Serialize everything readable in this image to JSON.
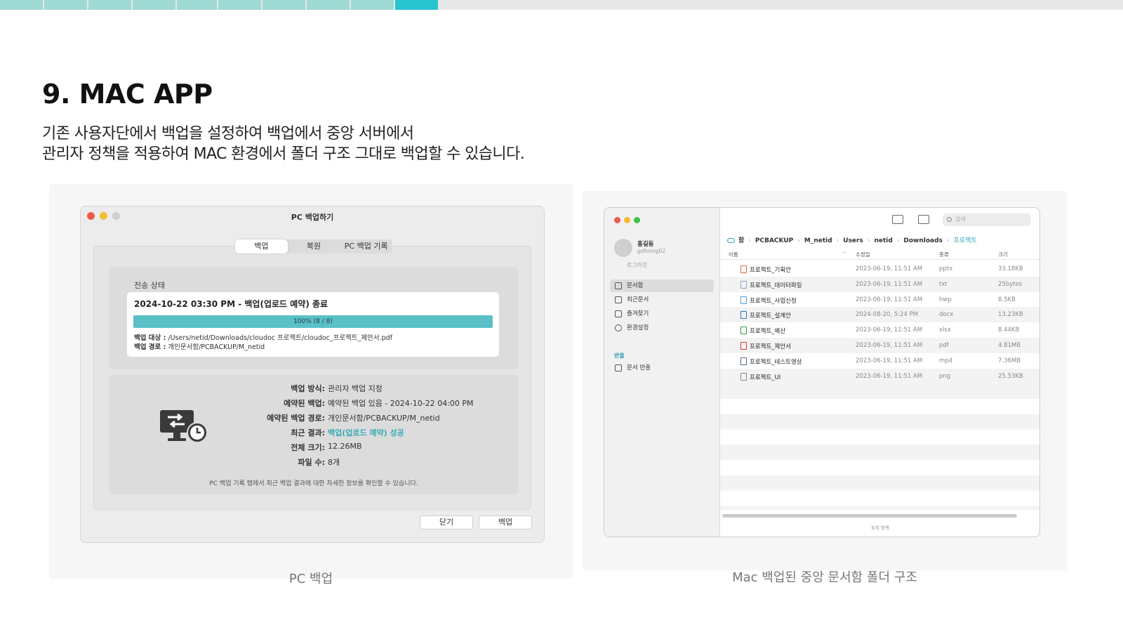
{
  "progress_strip": {
    "segments_total": 10,
    "active_index": 9
  },
  "heading": {
    "title": "9. MAC APP",
    "line1": "기존 사용자단에서 백업을 설정하여 백업에서 중앙 서버에서",
    "line2": "관리자 정책을 적용하여 MAC 환경에서 폴더 구조 그대로 백업할 수 있습니다."
  },
  "pc_backup": {
    "window_title": "PC 백업하기",
    "tabs": [
      "백업",
      "복원",
      "PC 백업 기록"
    ],
    "selected_tab": "백업",
    "status_label": "전송 상태",
    "status_heading": "2024-10-22 03:30 PM - 백업(업로드 예약) 종료",
    "progress_text": "100% (8 / 8)",
    "progress_fraction": 1.0,
    "target_label": "백업 대상 :",
    "target_value": "/Users/netid/Downloads/cloudoc 프로젝트/cloudoc_프로젝트_제안서.pdf",
    "path_label": "백업 경로 :",
    "path_value": "개인문서함/PCBACKUP/M_netid",
    "info": [
      {
        "key": "백업 방식:",
        "value": "관리자 백업 지정"
      },
      {
        "key": "예약된 백업:",
        "value": "예약된 백업 있음 - 2024-10-22 04:00 PM"
      },
      {
        "key": "예약된 백업 경로:",
        "value": "개인문서함/PCBACKUP/M_netid"
      },
      {
        "key": "최근 결과:",
        "value": "백업(업로드 예약) 성공"
      },
      {
        "key": "전체 크기:",
        "value": "12.26MB"
      },
      {
        "key": "파일 수:",
        "value": "8개"
      }
    ],
    "note": "PC 백업 기록 탭에서 최근 백업 결과에 대한 자세한 정보를 확인할 수 있습니다.",
    "close_button": "닫기",
    "backup_button": "백업",
    "caption": "PC 백업",
    "icon": "backup-schedule-icon",
    "accent_color": "#37aab6"
  },
  "finder": {
    "user_name": "홍길동",
    "user_id": "gdhong02",
    "logout": "로그아웃",
    "sidebar": [
      {
        "label": "문서함",
        "icon": "documents-icon",
        "selected": true
      },
      {
        "label": "최근문서",
        "icon": "recent-icon",
        "selected": false
      },
      {
        "label": "즐겨찾기",
        "icon": "favorites-icon",
        "selected": false
      },
      {
        "label": "환경설정",
        "icon": "gear-icon",
        "selected": false
      }
    ],
    "section_label": "반출",
    "section_item": "문서 반출",
    "search_placeholder": "검색",
    "breadcrumbs": [
      "함",
      "PCBACKUP",
      "M_netid",
      "Users",
      "netid",
      "Downloads"
    ],
    "breadcrumb_current": "프로젝트",
    "columns": {
      "name": "이름",
      "modified": "수정일",
      "kind": "종류",
      "size": "크기"
    },
    "files": [
      {
        "name": "프로젝트_기획안",
        "date": "2023-06-19, 11:51 AM",
        "type": "pptx",
        "size": "33.18KB",
        "color": "#e0693c"
      },
      {
        "name": "프로젝트_데이터파일",
        "date": "2023-06-19, 11:51 AM",
        "type": "txt",
        "size": "25bytes",
        "color": "#8aa2c8"
      },
      {
        "name": "프로젝트_사업신청",
        "date": "2023-06-19, 11:51 AM",
        "type": "hwp",
        "size": "8.5KB",
        "color": "#4aa3df"
      },
      {
        "name": "프로젝트_설계안",
        "date": "2024-08-20, 5:24 PM",
        "type": "docx",
        "size": "13.23KB",
        "color": "#2d6bc4"
      },
      {
        "name": "프로젝트_예산",
        "date": "2023-06-19, 11:51 AM",
        "type": "xlsx",
        "size": "8.44KB",
        "color": "#2f9a4a"
      },
      {
        "name": "프로젝트_제안서",
        "date": "2023-06-19, 11:51 AM",
        "type": "pdf",
        "size": "4.81MB",
        "color": "#d9362f"
      },
      {
        "name": "프로젝트_테스트영상",
        "date": "2023-06-19, 11:51 AM",
        "type": "mp4",
        "size": "7.36MB",
        "color": "#4f6b8a"
      },
      {
        "name": "프로젝트_UI",
        "date": "2023-06-19, 11:51 AM",
        "type": "png",
        "size": "25.53KB",
        "color": "#7a8899"
      }
    ],
    "item_count": "8개 항목",
    "caption": "Mac 백업된 중앙 문서함 폴더 구조"
  }
}
